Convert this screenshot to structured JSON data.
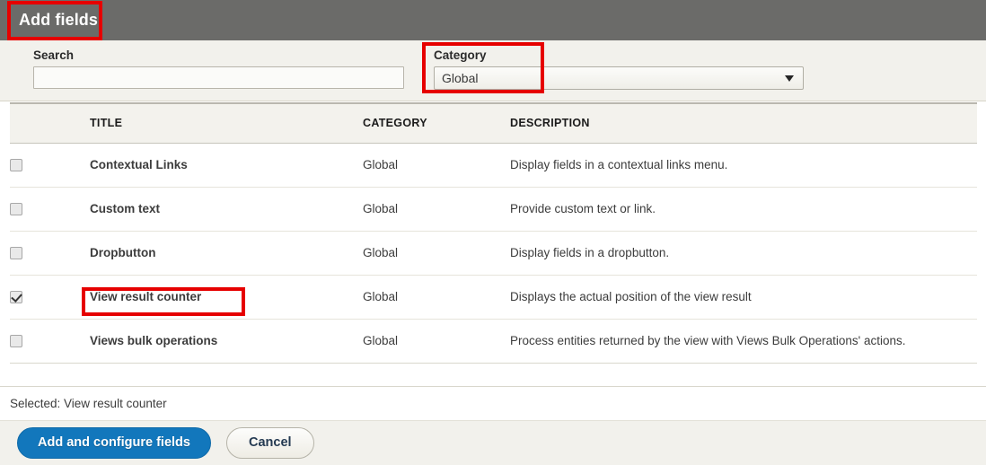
{
  "header": {
    "title": "Add fields"
  },
  "filters": {
    "search": {
      "label": "Search",
      "value": "",
      "placeholder": ""
    },
    "category": {
      "label": "Category",
      "selected": "Global",
      "arrow_icon": "chevron-down-icon"
    }
  },
  "table": {
    "columns": [
      "TITLE",
      "CATEGORY",
      "DESCRIPTION"
    ],
    "rows": [
      {
        "checked": false,
        "title": "Contextual Links",
        "category": "Global",
        "description": "Display fields in a contextual links menu."
      },
      {
        "checked": false,
        "title": "Custom text",
        "category": "Global",
        "description": "Provide custom text or link."
      },
      {
        "checked": false,
        "title": "Dropbutton",
        "category": "Global",
        "description": "Display fields in a dropbutton."
      },
      {
        "checked": true,
        "title": "View result counter",
        "category": "Global",
        "description": "Displays the actual position of the view result"
      },
      {
        "checked": false,
        "title": "Views bulk operations",
        "category": "Global",
        "description": "Process entities returned by the view with Views Bulk Operations' actions."
      }
    ]
  },
  "selected_summary": "Selected: View result counter",
  "footer": {
    "primary_label": "Add and configure fields",
    "secondary_label": "Cancel"
  },
  "annotations": {
    "highlight_color": "#e60000",
    "boxes": [
      "add-fields-title",
      "category-filter",
      "view-result-counter-title"
    ]
  },
  "colors": {
    "header_bar": "#6b6b69",
    "filter_bg": "#f2f1ec",
    "primary_button": "#1277bc",
    "table_header_bg": "#f3f2ed"
  }
}
